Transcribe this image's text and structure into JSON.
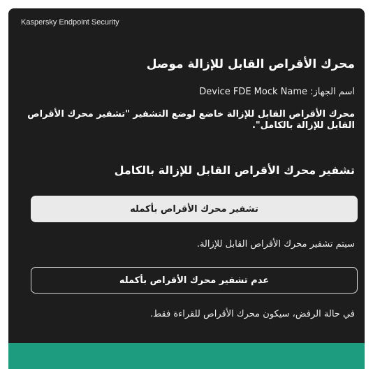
{
  "app": {
    "title": "Kaspersky Endpoint Security"
  },
  "dialog": {
    "heading": "محرك الأقراص القابل للإزالة موصل",
    "device_line": "اسم الجهاز: Device FDE Mock Name",
    "status_text": "محرك الأقراص القابل للإزالة خاضع لوضع التشفير \"تشفير محرك الأقراص القابل للإزالة بالكامل\".",
    "section_heading": "تشفير محرك الأقراص القابل للإزالة بالكامل",
    "encrypt_button_label": "تشفير محرك الأقراص بأكمله",
    "encrypt_hint": "سيتم تشفير محرك الأقراص القابل للإزالة.",
    "decline_button_label": "عدم تشفير محرك الأقراص بأكمله",
    "decline_hint": "في حالة الرفض، سيكون محرك الأقراص للقراءة فقط."
  },
  "colors": {
    "window_background": "#1d1d1d",
    "primary_button": "#eaeaea",
    "accent_footer": "#1e9c80"
  }
}
